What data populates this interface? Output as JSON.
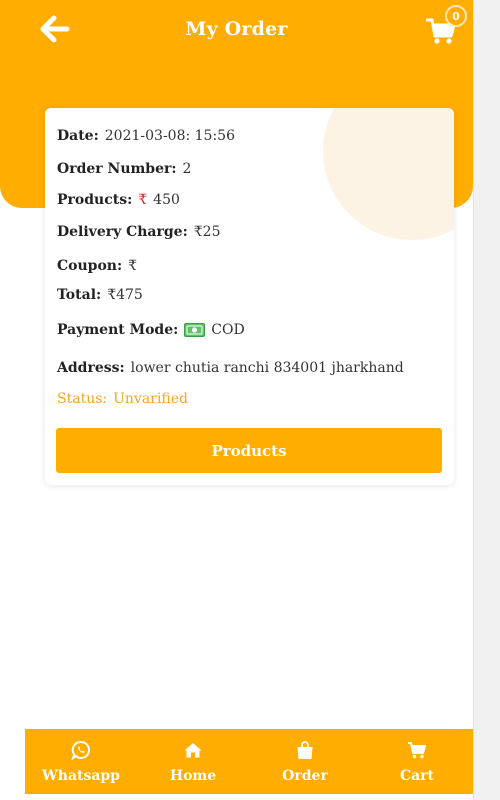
{
  "header": {
    "title": "My Order",
    "back_icon": "arrow-left-icon",
    "cart_icon": "cart-icon",
    "cart_count": "0"
  },
  "order": {
    "date_label": "Date:",
    "date_value": "2021-03-08: 15:56",
    "order_number_label": "Order Number:",
    "order_number_value": "2",
    "products_label": "Products:",
    "products_currency": "₹",
    "products_value": "450",
    "delivery_label": "Delivery Charge:",
    "delivery_value": "₹25",
    "coupon_label": "Coupon:",
    "coupon_value": "₹",
    "total_label": "Total:",
    "total_value": "₹475",
    "payment_label": "Payment Mode:",
    "payment_icon": "cash-icon",
    "payment_value": "COD",
    "address_label": "Address:",
    "address_value": "lower chutia ranchi 834001 jharkhand",
    "status_label": "Status:",
    "status_value": "Unvarified",
    "products_button": "Products"
  },
  "bottom_nav": [
    {
      "label": "Whatsapp",
      "icon": "whatsapp-icon"
    },
    {
      "label": "Home",
      "icon": "home-icon"
    },
    {
      "label": "Order",
      "icon": "shopping-bag-icon"
    },
    {
      "label": "Cart",
      "icon": "cart-icon"
    }
  ],
  "colors": {
    "primary": "#ffad00",
    "status": "#f7a325",
    "rupee_red": "#e02020",
    "decor_circle": "#fdf3e5"
  }
}
